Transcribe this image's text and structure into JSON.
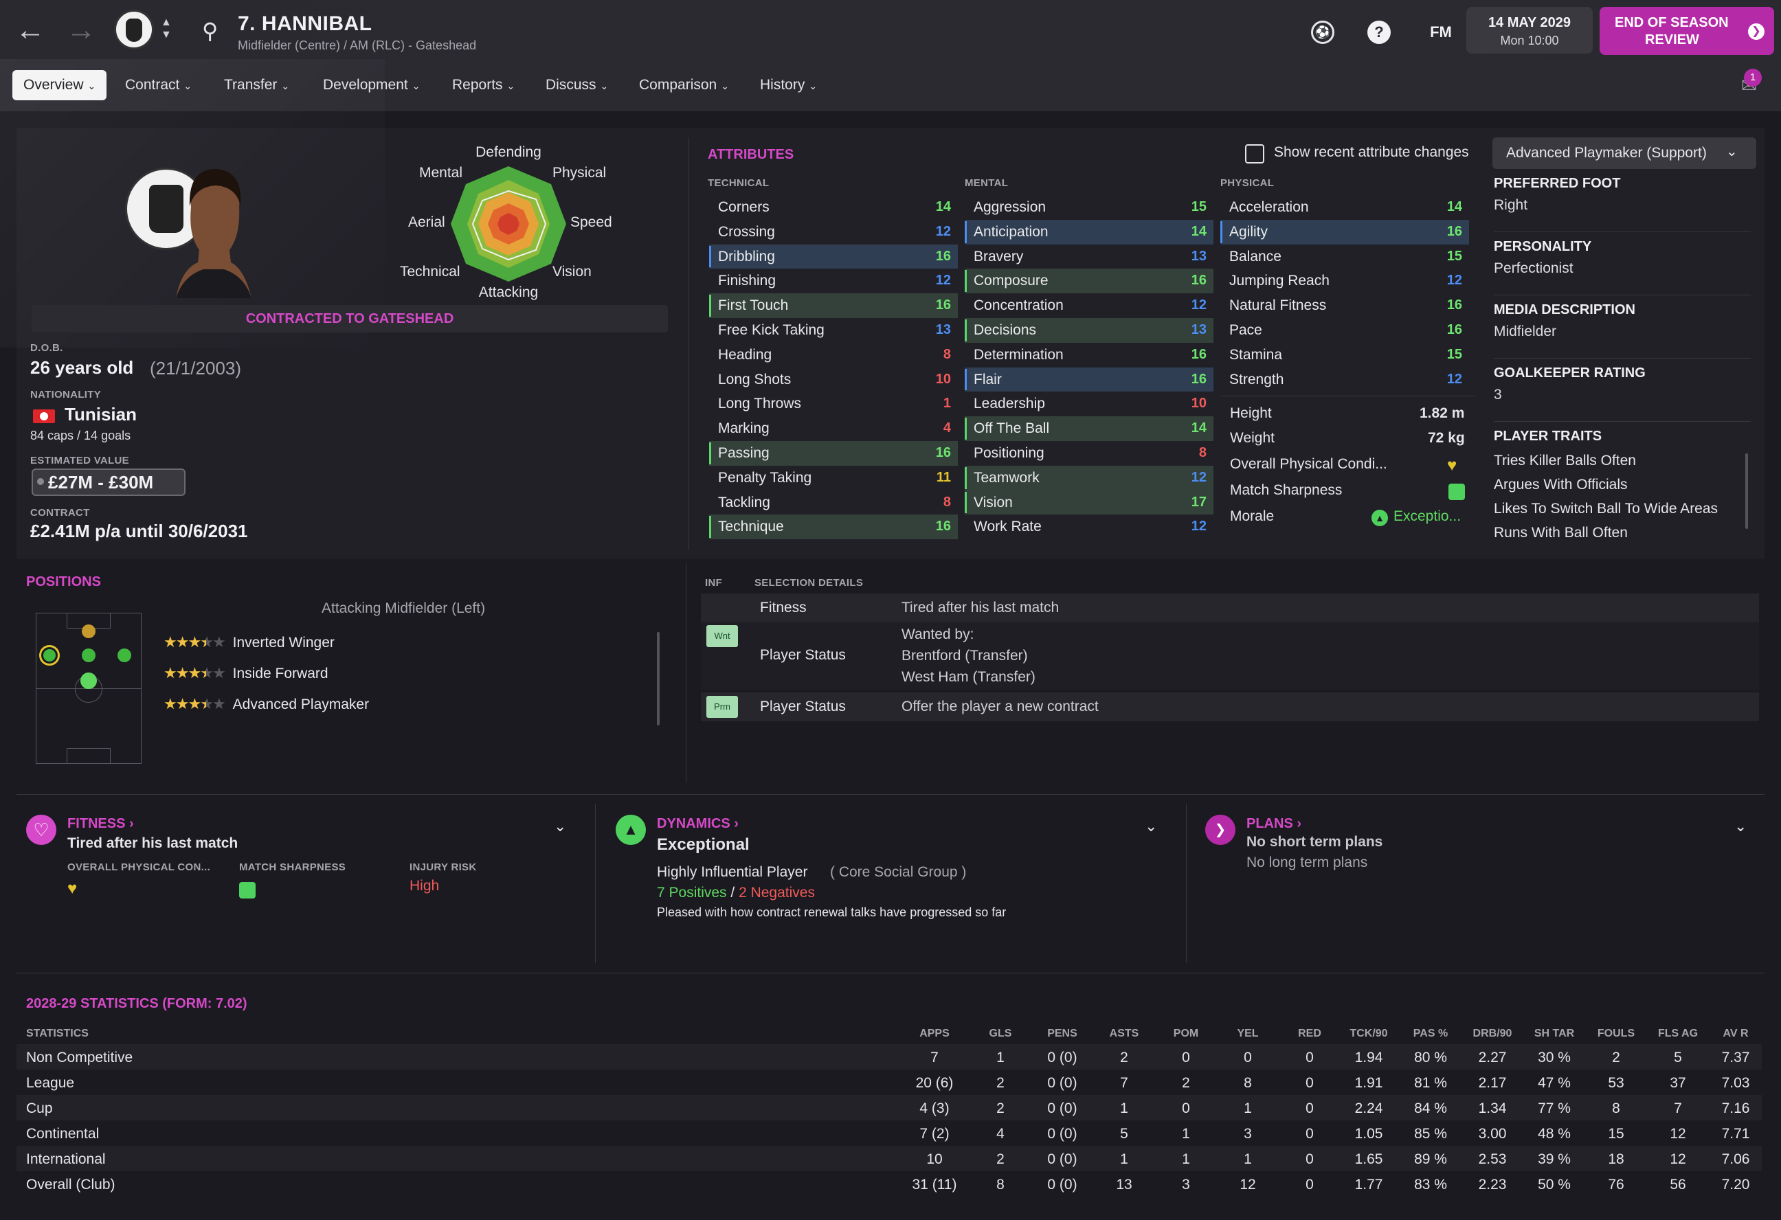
{
  "header": {
    "title": "7. HANNIBAL",
    "subtitle": "Midfielder (Centre) / AM (RLC) - Gateshead",
    "fm": "FM",
    "help": "?",
    "date": "14 MAY 2029",
    "time": "Mon 10:00",
    "eos_line1": "END OF SEASON",
    "eos_line2": "REVIEW",
    "notif_count": "1"
  },
  "tabs": [
    {
      "label": "Overview"
    },
    {
      "label": "Contract"
    },
    {
      "label": "Transfer"
    },
    {
      "label": "Development"
    },
    {
      "label": "Reports"
    },
    {
      "label": "Discuss"
    },
    {
      "label": "Comparison"
    },
    {
      "label": "History"
    }
  ],
  "radar": {
    "defending": "Defending",
    "physical": "Physical",
    "speed": "Speed",
    "vision": "Vision",
    "attacking": "Attacking",
    "technical": "Technical",
    "aerial": "Aerial",
    "mental": "Mental"
  },
  "profile": {
    "contracted": "CONTRACTED TO GATESHEAD",
    "dob_label": "D.O.B.",
    "age": "26 years old",
    "dob": "(21/1/2003)",
    "nat_label": "NATIONALITY",
    "nationality": "Tunisian",
    "caps": "84 caps / 14 goals",
    "value_label": "ESTIMATED VALUE",
    "value": "£27M - £30M",
    "contract_label": "CONTRACT",
    "contract": "£2.41M p/a until 30/6/2031"
  },
  "attributes": {
    "title": "ATTRIBUTES",
    "show_changes": "Show recent attribute changes",
    "role": "Advanced Playmaker (Support)",
    "technical_label": "TECHNICAL",
    "mental_label": "MENTAL",
    "physical_label": "PHYSICAL",
    "technical": [
      {
        "n": "Corners",
        "v": "14"
      },
      {
        "n": "Crossing",
        "v": "12"
      },
      {
        "n": "Dribbling",
        "v": "16"
      },
      {
        "n": "Finishing",
        "v": "12"
      },
      {
        "n": "First Touch",
        "v": "16"
      },
      {
        "n": "Free Kick Taking",
        "v": "13"
      },
      {
        "n": "Heading",
        "v": "8"
      },
      {
        "n": "Long Shots",
        "v": "10"
      },
      {
        "n": "Long Throws",
        "v": "1"
      },
      {
        "n": "Marking",
        "v": "4"
      },
      {
        "n": "Passing",
        "v": "16"
      },
      {
        "n": "Penalty Taking",
        "v": "11"
      },
      {
        "n": "Tackling",
        "v": "8"
      },
      {
        "n": "Technique",
        "v": "16"
      }
    ],
    "mental": [
      {
        "n": "Aggression",
        "v": "15"
      },
      {
        "n": "Anticipation",
        "v": "14"
      },
      {
        "n": "Bravery",
        "v": "13"
      },
      {
        "n": "Composure",
        "v": "16"
      },
      {
        "n": "Concentration",
        "v": "12"
      },
      {
        "n": "Decisions",
        "v": "13"
      },
      {
        "n": "Determination",
        "v": "16"
      },
      {
        "n": "Flair",
        "v": "16"
      },
      {
        "n": "Leadership",
        "v": "10"
      },
      {
        "n": "Off The Ball",
        "v": "14"
      },
      {
        "n": "Positioning",
        "v": "8"
      },
      {
        "n": "Teamwork",
        "v": "12"
      },
      {
        "n": "Vision",
        "v": "17"
      },
      {
        "n": "Work Rate",
        "v": "12"
      }
    ],
    "physical": [
      {
        "n": "Acceleration",
        "v": "14"
      },
      {
        "n": "Agility",
        "v": "16"
      },
      {
        "n": "Balance",
        "v": "15"
      },
      {
        "n": "Jumping Reach",
        "v": "12"
      },
      {
        "n": "Natural Fitness",
        "v": "16"
      },
      {
        "n": "Pace",
        "v": "16"
      },
      {
        "n": "Stamina",
        "v": "15"
      },
      {
        "n": "Strength",
        "v": "12"
      }
    ],
    "height_label": "Height",
    "height": "1.82 m",
    "weight_label": "Weight",
    "weight": "72 kg",
    "opc_label": "Overall Physical Condi...",
    "sharp_label": "Match Sharpness",
    "morale_label": "Morale",
    "morale": "Exceptio..."
  },
  "info": {
    "foot_label": "PREFERRED FOOT",
    "foot": "Right",
    "pers_label": "PERSONALITY",
    "pers": "Perfectionist",
    "media_label": "MEDIA DESCRIPTION",
    "media": "Midfielder",
    "gk_label": "GOALKEEPER RATING",
    "gk": "3",
    "traits_label": "PLAYER TRAITS",
    "traits": [
      "Tries Killer Balls Often",
      "Argues With Officials",
      "Likes To Switch Ball To Wide Areas",
      "Runs With Ball Often"
    ]
  },
  "positions": {
    "title": "POSITIONS",
    "current": "Attacking Midfielder (Left)",
    "roles": [
      {
        "name": "Inverted Winger",
        "stars": 3.5
      },
      {
        "name": "Inside Forward",
        "stars": 3.5
      },
      {
        "name": "Advanced Playmaker",
        "stars": 3.5
      }
    ]
  },
  "selection": {
    "inf": "INF",
    "title": "SELECTION DETAILS",
    "r1_label": "Fitness",
    "r1_val": "Tired after his last match",
    "r2_badge": "Wnt",
    "r2_label": "Player Status",
    "r2_l1": "Wanted by:",
    "r2_l2": "Brentford (Transfer)",
    "r2_l3": "West Ham (Transfer)",
    "r3_badge": "Prm",
    "r3_label": "Player Status",
    "r3_val": "Offer the player a new contract"
  },
  "fitness": {
    "title": "FITNESS",
    "status": "Tired after his last match",
    "opc": "OVERALL PHYSICAL CON...",
    "sharp": "MATCH SHARPNESS",
    "risk_label": "INJURY RISK",
    "risk": "High"
  },
  "dynamics": {
    "title": "DYNAMICS",
    "status": "Exceptional",
    "influence": "Highly Influential Player",
    "group": "( Core Social Group )",
    "pos": "7 Positives",
    "sep": "/",
    "neg": "2 Negatives",
    "note": "Pleased with how contract renewal talks have progressed so far"
  },
  "plans": {
    "title": "PLANS",
    "short": "No short term plans",
    "long": "No long term plans"
  },
  "stats": {
    "title": "2028-29 STATISTICS (FORM: 7.02)",
    "head": [
      "STATISTICS",
      "APPS",
      "GLS",
      "PENS",
      "ASTS",
      "POM",
      "YEL",
      "RED",
      "TCK/90",
      "PAS %",
      "DRB/90",
      "SH TAR",
      "FOULS",
      "FLS AG",
      "AV R"
    ],
    "rows": [
      [
        "Non Competitive",
        "7",
        "1",
        "0 (0)",
        "2",
        "0",
        "0",
        "0",
        "1.94",
        "80 %",
        "2.27",
        "30 %",
        "2",
        "5",
        "7.37"
      ],
      [
        "League",
        "20 (6)",
        "2",
        "0 (0)",
        "7",
        "2",
        "8",
        "0",
        "1.91",
        "81 %",
        "2.17",
        "47 %",
        "53",
        "37",
        "7.03"
      ],
      [
        "Cup",
        "4 (3)",
        "2",
        "0 (0)",
        "1",
        "0",
        "1",
        "0",
        "2.24",
        "84 %",
        "1.34",
        "77 %",
        "8",
        "7",
        "7.16"
      ],
      [
        "Continental",
        "7 (2)",
        "4",
        "0 (0)",
        "5",
        "1",
        "3",
        "0",
        "1.05",
        "85 %",
        "3.00",
        "48 %",
        "15",
        "12",
        "7.71"
      ],
      [
        "International",
        "10",
        "2",
        "0 (0)",
        "1",
        "1",
        "1",
        "0",
        "1.65",
        "89 %",
        "2.53",
        "39 %",
        "18",
        "12",
        "7.06"
      ],
      [
        "Overall (Club)",
        "31 (11)",
        "8",
        "0 (0)",
        "13",
        "3",
        "12",
        "0",
        "1.77",
        "83 %",
        "2.23",
        "50 %",
        "76",
        "56",
        "7.20"
      ]
    ]
  },
  "colors": {
    "accent": "#d649c8",
    "button": "#b52aa6",
    "good": "#5fd860",
    "blue": "#4d8ef2",
    "bad": "#f05a5a"
  }
}
